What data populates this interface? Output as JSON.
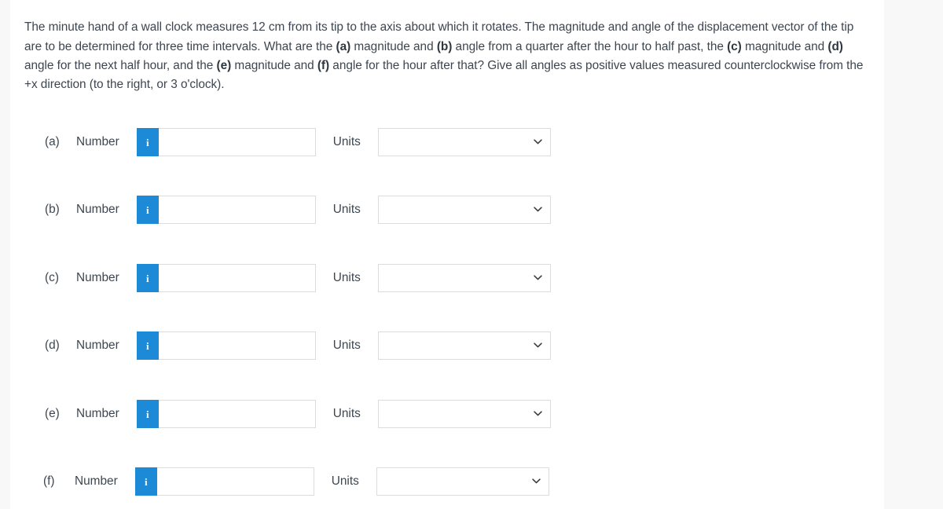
{
  "question": {
    "segments": [
      {
        "t": "The minute hand of a wall clock measures 12 cm from its tip to the axis about which it rotates. The magnitude and angle of the displacement vector of the tip are to be determined for three time intervals. What are the ",
        "b": false
      },
      {
        "t": "(a)",
        "b": true
      },
      {
        "t": " magnitude and ",
        "b": false
      },
      {
        "t": "(b)",
        "b": true
      },
      {
        "t": " angle from a quarter after the hour to half past, the ",
        "b": false
      },
      {
        "t": "(c)",
        "b": true
      },
      {
        "t": " magnitude and ",
        "b": false
      },
      {
        "t": "(d)",
        "b": true
      },
      {
        "t": " angle for the next half hour, and the ",
        "b": false
      },
      {
        "t": "(e)",
        "b": true
      },
      {
        "t": " magnitude and ",
        "b": false
      },
      {
        "t": "(f)",
        "b": true
      },
      {
        "t": " angle for the hour after that? Give all angles as positive values measured counterclockwise from the +x direction (to the right, or 3 o'clock).",
        "b": false
      }
    ],
    "plain": "The minute hand of a wall clock measures 12 cm from its tip to the axis about which it rotates. The magnitude and angle of the displacement vector of the tip are to be determined for three time intervals. What are the (a) magnitude and (b) angle from a quarter after the hour to half past, the (c) magnitude and (d) angle for the next half hour, and the (e) magnitude and (f) angle for the hour after that? Give all angles as positive values measured counterclockwise from the +x direction (to the right, or 3 o'clock)."
  },
  "labels": {
    "number": "Number",
    "units": "Units",
    "info_icon": "i",
    "chevron_icon": "chevron-down-icon"
  },
  "colors": {
    "accent_blue": "#1c8ad6",
    "text": "#3d4650",
    "border": "#dcdcdc",
    "page_bg": "#f8f8f8",
    "content_bg": "#ffffff"
  },
  "rows": [
    {
      "key": "a",
      "label": "(a)",
      "number_value": "",
      "number_placeholder": "",
      "units_value": "",
      "units_options": [
        ""
      ]
    },
    {
      "key": "b",
      "label": "(b)",
      "number_value": "",
      "number_placeholder": "",
      "units_value": "",
      "units_options": [
        ""
      ]
    },
    {
      "key": "c",
      "label": "(c)",
      "number_value": "",
      "number_placeholder": "",
      "units_value": "",
      "units_options": [
        ""
      ]
    },
    {
      "key": "d",
      "label": "(d)",
      "number_value": "",
      "number_placeholder": "",
      "units_value": "",
      "units_options": [
        ""
      ]
    },
    {
      "key": "e",
      "label": "(e)",
      "number_value": "",
      "number_placeholder": "",
      "units_value": "",
      "units_options": [
        ""
      ]
    },
    {
      "key": "f",
      "label": "(f)",
      "number_value": "",
      "number_placeholder": "",
      "units_value": "",
      "units_options": [
        ""
      ]
    }
  ],
  "layout": {
    "row_tops": [
      161,
      247,
      334,
      420,
      507,
      593
    ],
    "row_lefts": [
      44,
      44,
      44,
      44,
      44,
      42
    ]
  }
}
